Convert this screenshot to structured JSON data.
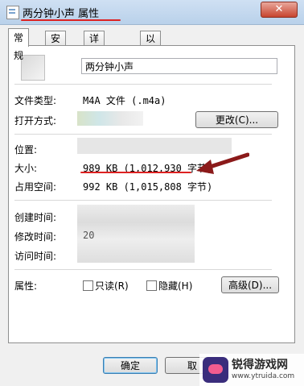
{
  "window": {
    "title": "两分钟小声 属性",
    "close_label": "✕"
  },
  "tabs": [
    "常规",
    "安全",
    "详细信息",
    "以前的版本"
  ],
  "general": {
    "file_name": "两分钟小声",
    "type_label": "文件类型:",
    "type_value": "M4A 文件 (.m4a)",
    "open_with_label": "打开方式:",
    "change_button": "更改(C)...",
    "location_label": "位置:",
    "size_label": "大小:",
    "size_value": "989 KB (1,012,930 字节)",
    "size_on_disk_label": "占用空间:",
    "size_on_disk_value": "992 KB (1,015,808 字节)",
    "created_label": "创建时间:",
    "modified_label": "修改时间:",
    "modified_value_partial": "20",
    "accessed_label": "访问时间:",
    "attributes_label": "属性:",
    "readonly_label": "只读(R)",
    "hidden_label": "隐藏(H)",
    "advanced_button": "高级(D)..."
  },
  "footer": {
    "ok_button": "确定",
    "cancel_button": "取"
  },
  "watermark": {
    "title": "锐得游戏网",
    "url": "www.ytruida.com"
  }
}
